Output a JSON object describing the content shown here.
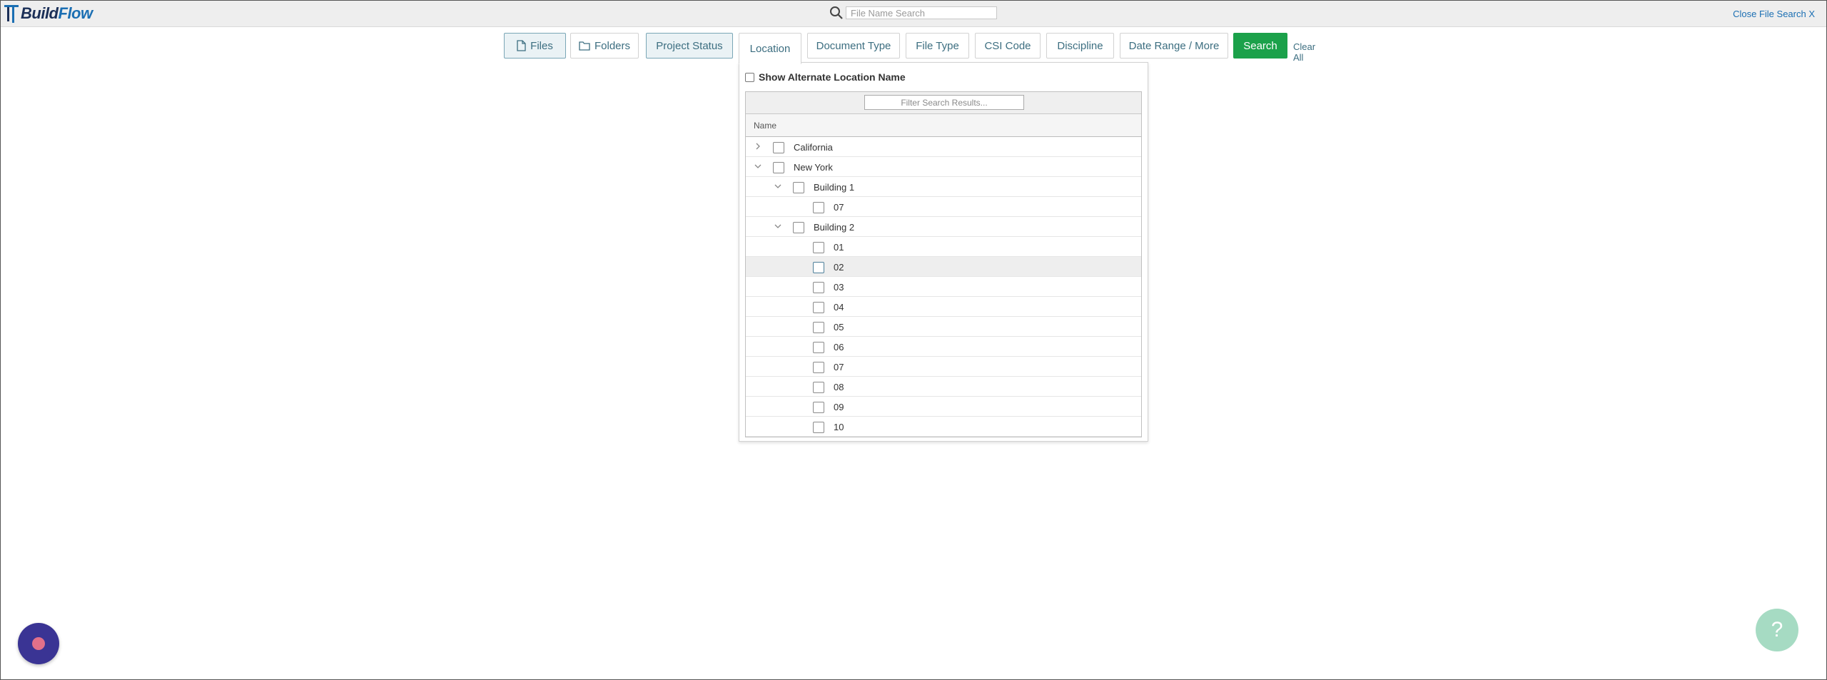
{
  "brand": {
    "name_part1": "Build",
    "name_part2": "Flow",
    "logo_icon": "buildflow-logo-icon"
  },
  "header": {
    "search_placeholder": "File Name Search",
    "search_icon": "search-icon",
    "close_label": "Close File Search X"
  },
  "filters": {
    "tabs": [
      {
        "label": "Files",
        "icon": "file-icon"
      },
      {
        "label": "Folders",
        "icon": "folder-icon"
      },
      {
        "label": "Project Status"
      },
      {
        "label": "Location"
      },
      {
        "label": "Document Type"
      },
      {
        "label": "File Type"
      },
      {
        "label": "CSI Code"
      },
      {
        "label": "Discipline"
      },
      {
        "label": "Date Range / More"
      }
    ],
    "search_label": "Search",
    "clear_label": "Clear All",
    "colors": {
      "search_button": "#1ba14a",
      "tab_text": "#3c6e80"
    }
  },
  "location_panel": {
    "alt_name_label": "Show Alternate Location Name",
    "filter_placeholder": "Filter Search Results...",
    "column_header": "Name",
    "rows": [
      {
        "label": "California",
        "level": 0,
        "expander": "collapsed"
      },
      {
        "label": "New York",
        "level": 0,
        "expander": "expanded"
      },
      {
        "label": "Building 1",
        "level": 1,
        "expander": "expanded"
      },
      {
        "label": "07",
        "level": 2
      },
      {
        "label": "Building 2",
        "level": 1,
        "expander": "expanded"
      },
      {
        "label": "01",
        "level": 2
      },
      {
        "label": "02",
        "level": 2,
        "hovered": true
      },
      {
        "label": "03",
        "level": 2
      },
      {
        "label": "04",
        "level": 2
      },
      {
        "label": "05",
        "level": 2
      },
      {
        "label": "06",
        "level": 2
      },
      {
        "label": "07",
        "level": 2
      },
      {
        "label": "08",
        "level": 2
      },
      {
        "label": "09",
        "level": 2
      },
      {
        "label": "10",
        "level": 2
      }
    ]
  },
  "widgets": {
    "left_icon": "chat-widget-icon",
    "right_glyph": "?",
    "right_icon": "help-icon"
  }
}
